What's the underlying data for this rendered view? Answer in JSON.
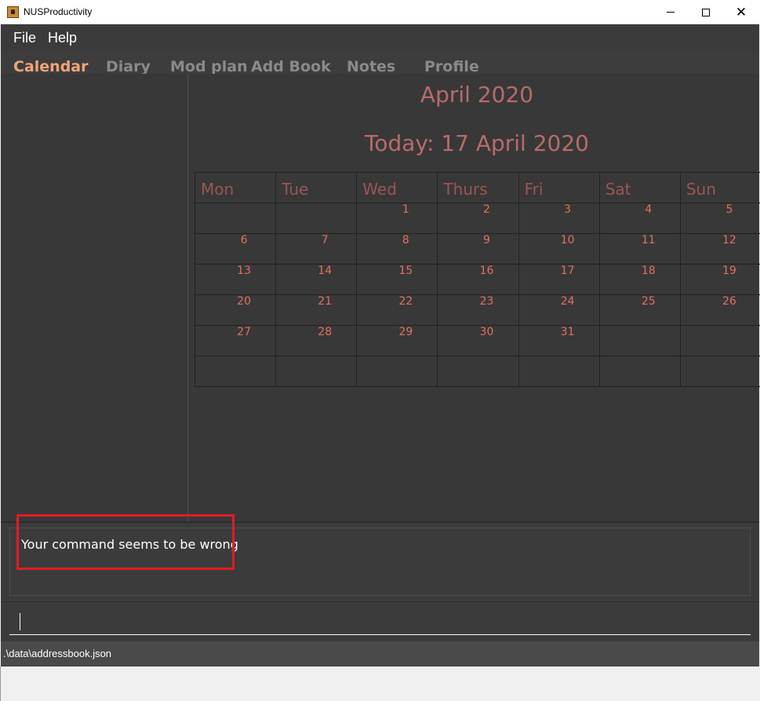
{
  "window": {
    "title": "NUSProductivity",
    "minimize": "",
    "maximize": "",
    "close": "✕"
  },
  "menu": {
    "items": [
      "File",
      "Help"
    ]
  },
  "tabs": [
    "Calendar",
    "Diary",
    "Mod plan",
    "Add Book",
    "Notes",
    "Profile"
  ],
  "active_tab": "Calendar",
  "calendar": {
    "month_title": "April 2020",
    "today_label": "Today: 17 April 2020",
    "weekdays": [
      "Mon",
      "Tue",
      "Wed",
      "Thurs",
      "Fri",
      "Sat",
      "Sun"
    ],
    "weeks": [
      [
        "",
        "",
        "1",
        "2",
        "3",
        "4",
        "5"
      ],
      [
        "6",
        "7",
        "8",
        "9",
        "10",
        "11",
        "12"
      ],
      [
        "13",
        "14",
        "15",
        "16",
        "17",
        "18",
        "19"
      ],
      [
        "20",
        "21",
        "22",
        "23",
        "24",
        "25",
        "26"
      ],
      [
        "27",
        "28",
        "29",
        "30",
        "31",
        "",
        ""
      ],
      [
        "",
        "",
        "",
        "",
        "",
        "",
        ""
      ]
    ]
  },
  "result": {
    "message": "Your command seems to be wrong"
  },
  "command": {
    "value": ""
  },
  "status": {
    "path": ".\\data\\addressbook.json"
  },
  "colors": {
    "accent_tab": "#f2a478",
    "calendar_title": "#b86b6b",
    "date_number": "#e07060",
    "highlight": "#e01b24",
    "background": "#3b3b3b"
  }
}
